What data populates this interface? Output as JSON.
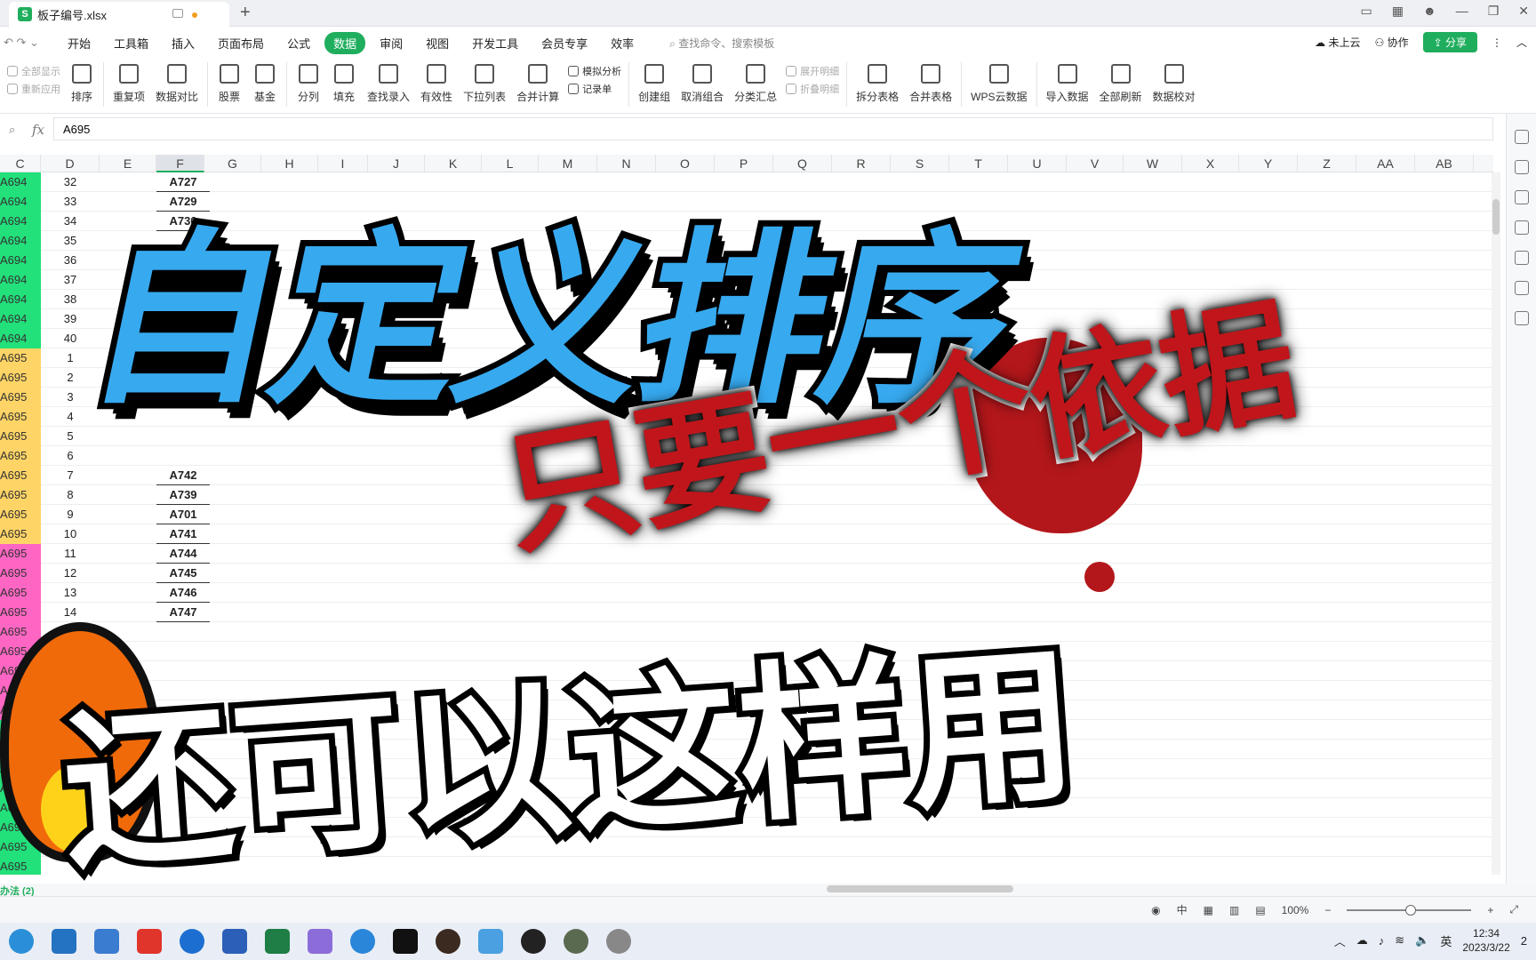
{
  "window": {
    "doc_title": "板子编号.xlsx",
    "wps_badge": "S"
  },
  "menubar": {
    "items": [
      "开始",
      "工具箱",
      "插入",
      "页面布局",
      "公式",
      "数据",
      "审阅",
      "视图",
      "开发工具",
      "会员专享",
      "效率"
    ],
    "active": "数据",
    "search_placeholder": "查找命令、搜索模板",
    "cloud": "未上云",
    "collab": "协作",
    "share": "分享"
  },
  "ribbon": {
    "show_all": "全部显示",
    "reapply": "重新应用",
    "sort": "排序",
    "dup": "重复项",
    "compare": "数据对比",
    "stocks": "股票",
    "fund": "基金",
    "split": "分列",
    "fill": "填充",
    "lookup": "查找录入",
    "validity": "有效性",
    "dropdown": "下拉列表",
    "consolidate": "合并计算",
    "whatif": "模拟分析",
    "records": "记录单",
    "group": "创建组",
    "ungroup": "取消组合",
    "subtotal": "分类汇总",
    "expand": "展开明细",
    "collapse": "折叠明细",
    "split_table": "拆分表格",
    "merge_table": "合并表格",
    "wps_cloud": "WPS云数据",
    "import": "导入数据",
    "refresh": "全部刷新",
    "check": "数据校对"
  },
  "formula": {
    "fx": "fx",
    "value": "A695"
  },
  "columns": [
    "C",
    "D",
    "E",
    "F",
    "G",
    "H",
    "I",
    "J",
    "K",
    "L",
    "M",
    "N",
    "O",
    "P",
    "Q",
    "R",
    "S",
    "T",
    "U",
    "V",
    "W",
    "X",
    "Y",
    "Z",
    "AA",
    "AB"
  ],
  "selected_column": "F",
  "rows": [
    {
      "c": "A694",
      "d": "32",
      "f": "A727",
      "color": "#22e07a"
    },
    {
      "c": "A694",
      "d": "33",
      "f": "A729",
      "color": "#22e07a"
    },
    {
      "c": "A694",
      "d": "34",
      "f": "A730",
      "color": "#22e07a"
    },
    {
      "c": "A694",
      "d": "35",
      "f": "",
      "color": "#22e07a"
    },
    {
      "c": "A694",
      "d": "36",
      "f": "",
      "color": "#22e07a"
    },
    {
      "c": "A694",
      "d": "37",
      "f": "",
      "color": "#22e07a"
    },
    {
      "c": "A694",
      "d": "38",
      "f": "",
      "color": "#22e07a"
    },
    {
      "c": "A694",
      "d": "39",
      "f": "",
      "color": "#22e07a"
    },
    {
      "c": "A694",
      "d": "40",
      "f": "",
      "color": "#22e07a"
    },
    {
      "c": "A695",
      "d": "1",
      "f": "",
      "color": "#ffd466"
    },
    {
      "c": "A695",
      "d": "2",
      "f": "",
      "color": "#ffd466"
    },
    {
      "c": "A695",
      "d": "3",
      "f": "",
      "color": "#ffd466"
    },
    {
      "c": "A695",
      "d": "4",
      "f": "",
      "color": "#ffd466"
    },
    {
      "c": "A695",
      "d": "5",
      "f": "",
      "color": "#ffd466"
    },
    {
      "c": "A695",
      "d": "6",
      "f": "",
      "color": "#ffd466"
    },
    {
      "c": "A695",
      "d": "7",
      "f": "A742",
      "color": "#ffd466"
    },
    {
      "c": "A695",
      "d": "8",
      "f": "A739",
      "color": "#ffd466"
    },
    {
      "c": "A695",
      "d": "9",
      "f": "A701",
      "color": "#ffd466"
    },
    {
      "c": "A695",
      "d": "10",
      "f": "A741",
      "color": "#ffd466"
    },
    {
      "c": "A695",
      "d": "11",
      "f": "A744",
      "color": "#ff66c4"
    },
    {
      "c": "A695",
      "d": "12",
      "f": "A745",
      "color": "#ff66c4"
    },
    {
      "c": "A695",
      "d": "13",
      "f": "A746",
      "color": "#ff66c4"
    },
    {
      "c": "A695",
      "d": "14",
      "f": "A747",
      "color": "#ff66c4"
    },
    {
      "c": "A695",
      "d": "",
      "f": "",
      "color": "#ff66c4"
    },
    {
      "c": "A695",
      "d": "",
      "f": "",
      "color": "#ff66c4"
    },
    {
      "c": "A695",
      "d": "",
      "f": "",
      "color": "#ff66c4"
    },
    {
      "c": "A695",
      "d": "",
      "f": "",
      "color": "#ff66c4"
    },
    {
      "c": "A695",
      "d": "",
      "f": "",
      "color": "#ff66c4"
    },
    {
      "c": "A695",
      "d": "",
      "f": "",
      "color": "#22e07a"
    },
    {
      "c": "A695",
      "d": "",
      "f": "",
      "color": "#22e07a"
    },
    {
      "c": "A695",
      "d": "",
      "f": "",
      "color": "#22e07a"
    },
    {
      "c": "A695",
      "d": "",
      "f": "",
      "color": "#22e07a"
    },
    {
      "c": "A695",
      "d": "",
      "f": "",
      "color": "#22e07a"
    },
    {
      "c": "A695",
      "d": "",
      "f": "",
      "color": "#22e07a"
    },
    {
      "c": "A695",
      "d": "",
      "f": "",
      "color": "#22e07a"
    },
    {
      "c": "A695",
      "d": "",
      "f": "",
      "color": "#22e07a"
    }
  ],
  "sheet": {
    "tab": "办法 (2)"
  },
  "status": {
    "zoom": "100%"
  },
  "taskbar": {
    "time": "12:34",
    "date": "2023/3/22",
    "ime": "英",
    "notif": "2"
  },
  "overlay": {
    "title": "自定义排序",
    "subtitle_red": "只要一个依据",
    "subtitle_white": "还可以这样用"
  },
  "colors": {
    "accent": "#1fae5d",
    "title_blue": "#37a9ef",
    "red": "#c0161b"
  }
}
